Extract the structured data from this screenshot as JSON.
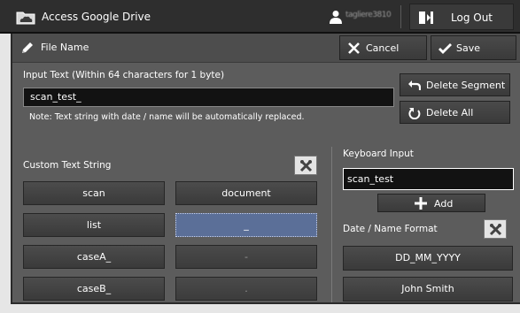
{
  "topbar": {
    "app_title": "Access Google Drive",
    "app_icon": "cloud-folder-icon",
    "user_icon": "user-icon",
    "user_name": "tagliere3810",
    "logout_icon": "logout-icon",
    "logout_label": "Log Out"
  },
  "header": {
    "icon": "pencil-icon",
    "title": "File Name",
    "cancel_label": "Cancel",
    "save_label": "Save"
  },
  "input_text": {
    "label": "Input Text (Within 64 characters for 1 byte)",
    "value": "scan_test_",
    "note": "Note: Text string with date / name will be automatically replaced.",
    "delete_segment_label": "Delete Segment",
    "delete_all_label": "Delete All"
  },
  "custom_text": {
    "label": "Custom Text String",
    "edit_icon": "tools-icon",
    "left_column": [
      "scan",
      "list",
      "caseA_",
      "caseB_"
    ],
    "right_column": [
      "document",
      "_",
      "-",
      "."
    ],
    "selected_index_right": 1
  },
  "keyboard_input": {
    "label": "Keyboard Input",
    "value": "scan_test",
    "add_label": "Add"
  },
  "date_name": {
    "label": "Date / Name Format",
    "edit_icon": "tools-icon",
    "options": [
      "DD_MM_YYYY",
      "John Smith"
    ]
  },
  "colors": {
    "topbar": "#2e2e2e",
    "panel": "#5c5c5c",
    "selected": "#5b6f98",
    "input_bg": "#121212"
  }
}
